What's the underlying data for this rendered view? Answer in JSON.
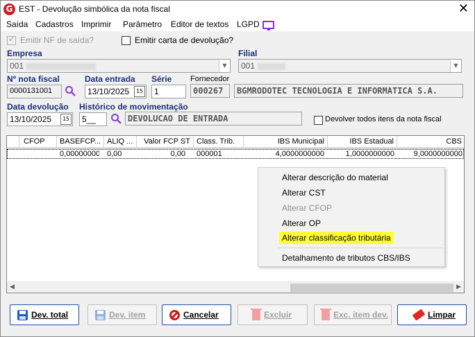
{
  "window": {
    "app_icon_letter": "G",
    "title": "EST - Devolução simbólica da nota fiscal",
    "close_symbol": "✕"
  },
  "menu": {
    "items": [
      "Saída",
      "Cadastros",
      "Imprimir",
      "Parâmetro",
      "Editor de textos",
      "LGPD"
    ]
  },
  "options": {
    "emitir_nf_label": "Emitir NF de saída?",
    "emitir_nf_checked": true,
    "emitir_nf_enabled": false,
    "emitir_carta_label": "Emitir carta de devolução?",
    "emitir_carta_checked": false
  },
  "empresa": {
    "label": "Empresa",
    "value": "001"
  },
  "filial": {
    "label": "Filial",
    "value": "001"
  },
  "nota": {
    "label": "Nº nota fiscal",
    "value": "0000131001"
  },
  "data_entrada": {
    "label": "Data entrada",
    "value": "13/10/2025",
    "cal_label": "15"
  },
  "serie": {
    "label": "Série",
    "value": "1"
  },
  "fornecedor": {
    "label": "Fornecedor",
    "code": "000267",
    "name": "BGMRODOTEC TECNOLOGIA E INFORMATICA S.A."
  },
  "data_devolucao": {
    "label": "Data devolução",
    "value": "13/10/2025",
    "cal_label": "15"
  },
  "historico": {
    "label": "Histórico de movimentação",
    "code": "5__",
    "description": "DEVOLUCAO DE ENTRADA"
  },
  "devolver_todos": {
    "label": "Devolver todos itens da nota fiscal",
    "checked": false
  },
  "grid": {
    "columns": [
      "CFOP",
      "BASEFCP...",
      "ALIQ ...",
      "Valor FCP ST",
      "Class. Trib.",
      "IBS Municipal",
      "IBS Estadual",
      "CBS"
    ],
    "rows": [
      [
        "",
        "0,00000000",
        "0,00",
        "0,00",
        "000001",
        "4,0000000000",
        "1,0000000000",
        "9,0000000000"
      ]
    ],
    "scroll_left": "◀",
    "scroll_right": "▶"
  },
  "context_menu": {
    "items": [
      {
        "label": "Alterar descrição do material",
        "enabled": true
      },
      {
        "label": "Alterar CST",
        "enabled": true
      },
      {
        "label": "Alterar CFOP",
        "enabled": false
      },
      {
        "label": "Alterar OP",
        "enabled": true
      },
      {
        "label": "Alterar classificação tributária",
        "enabled": true,
        "highlighted": true
      },
      {
        "label": "Detalhamento de tributos CBS/IBS",
        "enabled": true
      }
    ],
    "highlight_color": "#ffff33"
  },
  "buttons": {
    "dev_total": "Dev. total",
    "dev_item": "Dev. item",
    "cancelar": "Cancelar",
    "excluir": "Excluir",
    "exc_item_dev": "Exc. item dev.",
    "limpar": "Limpar"
  },
  "colors": {
    "label_blue": "#1a2f7a",
    "button_border": "#1c4fa0",
    "danger_red": "#d01818",
    "lgpd_purple": "#8a2be2"
  }
}
